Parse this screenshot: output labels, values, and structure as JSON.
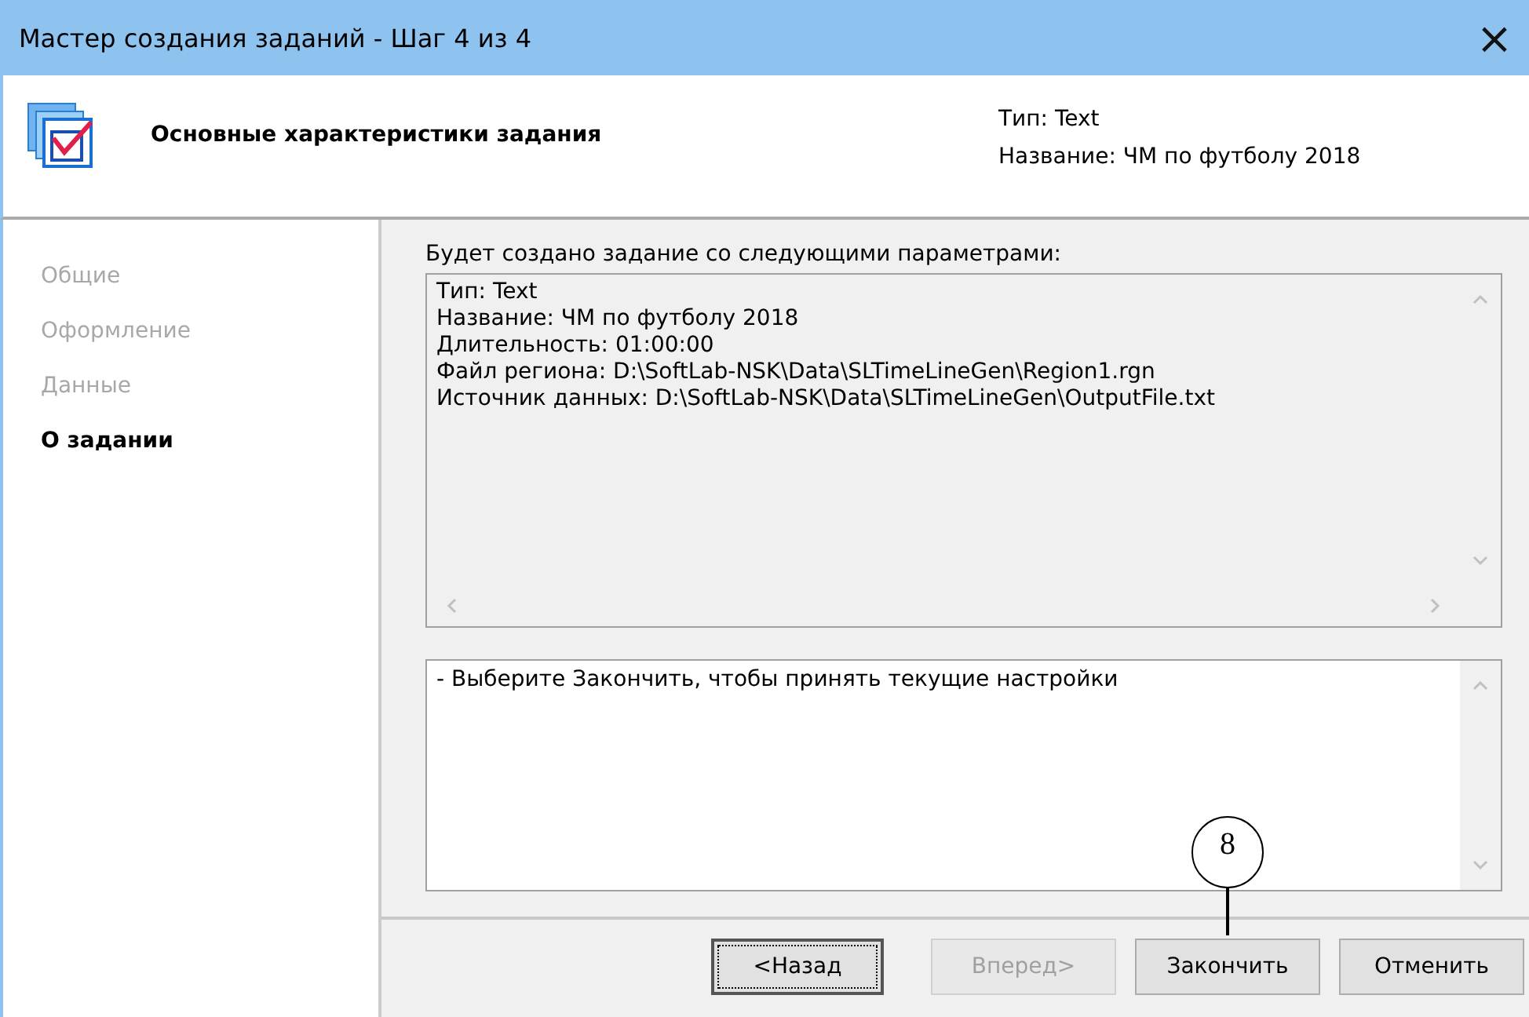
{
  "window": {
    "title": "Мастер создания заданий - Шаг 4 из 4",
    "close": "×"
  },
  "header": {
    "title": "Основные характеристики задания",
    "info": [
      "Тип: Text",
      "Название: ЧМ по футболу 2018"
    ]
  },
  "sidebar": {
    "items": [
      {
        "label": "Общие",
        "selected": false
      },
      {
        "label": "Оформление",
        "selected": false
      },
      {
        "label": "Данные",
        "selected": false
      },
      {
        "label": "О задании",
        "selected": true
      }
    ]
  },
  "summary": {
    "caption": "Будет создано задание со следующими параметрами:",
    "lines": [
      "Тип: Text",
      "Название: ЧМ по футболу 2018",
      "Длительность: 01:00:00",
      "Файл региона: D:\\SoftLab-NSK\\Data\\SLTimeLineGen\\Region1.rgn",
      "Источник данных: D:\\SoftLab-NSK\\Data\\SLTimeLineGen\\OutputFile.txt"
    ]
  },
  "notes": {
    "text": "- Выберите Закончить, чтобы принять текущие настройки"
  },
  "buttons": [
    {
      "label": "<Назад",
      "disabled": false,
      "focused": true
    },
    {
      "label": "Вперед>",
      "disabled": true,
      "focused": false
    },
    {
      "label": "Закончить",
      "disabled": false,
      "focused": false,
      "callout": "8"
    },
    {
      "label": "Отменить",
      "disabled": false,
      "focused": false
    }
  ]
}
